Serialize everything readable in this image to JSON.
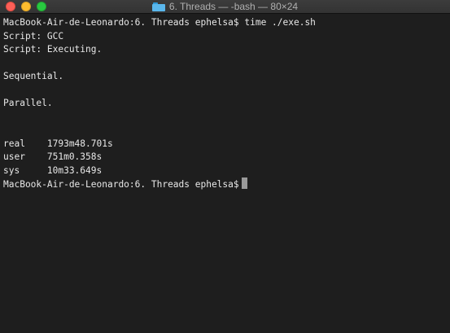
{
  "window": {
    "title": "6. Threads — -bash — 80×24",
    "icon": "folder-icon"
  },
  "terminal": {
    "lines": [
      "MacBook-Air-de-Leonardo:6. Threads ephelsa$ time ./exe.sh",
      "Script: GCC",
      "Script: Executing.",
      "",
      "Sequential.",
      "",
      "Parallel.",
      "",
      "",
      "real    1793m48.701s",
      "user    751m0.358s",
      "sys     10m33.649s"
    ],
    "prompt": "MacBook-Air-de-Leonardo:6. Threads ephelsa$"
  }
}
